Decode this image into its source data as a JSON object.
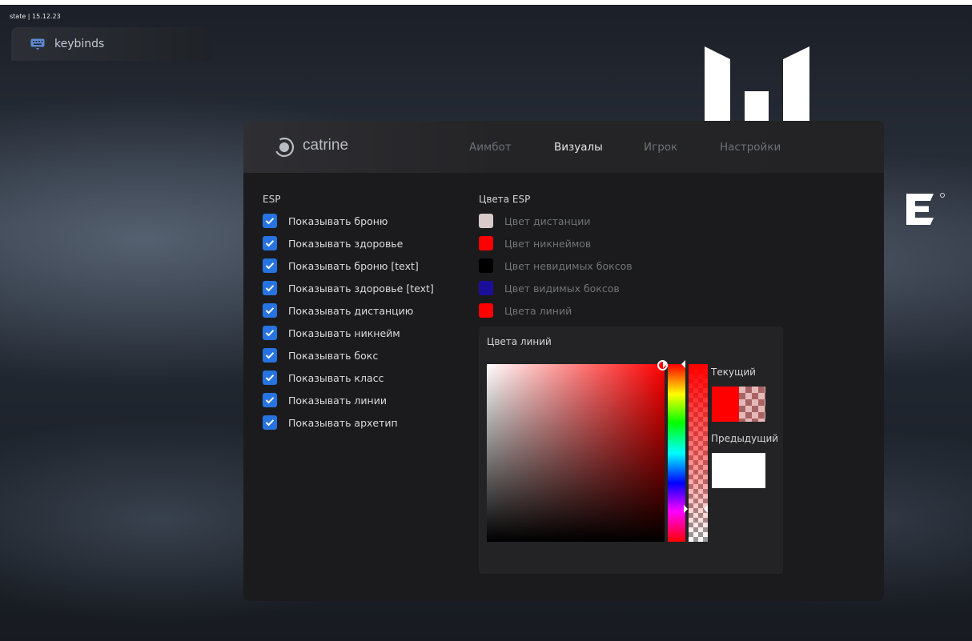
{
  "overlay": {
    "state_text": "state | 15.12.23"
  },
  "keybinds": {
    "label": "keybinds",
    "icon": "keyboard-icon"
  },
  "brand": {
    "name": "catrine",
    "icon": "target-ring-icon"
  },
  "tabs": [
    {
      "label": "Аимбот",
      "active": false
    },
    {
      "label": "Визуалы",
      "active": true
    },
    {
      "label": "Игрок",
      "active": false
    },
    {
      "label": "Настройки",
      "active": false
    }
  ],
  "esp": {
    "title": "ESP",
    "items": [
      {
        "label": "Показывать броню",
        "checked": true
      },
      {
        "label": "Показывать здоровье",
        "checked": true
      },
      {
        "label": "Показывать броню [text]",
        "checked": true
      },
      {
        "label": "Показывать здоровье [text]",
        "checked": true
      },
      {
        "label": "Показывать дистанцию",
        "checked": true
      },
      {
        "label": "Показывать никнейм",
        "checked": true
      },
      {
        "label": "Показывать бокс",
        "checked": true
      },
      {
        "label": "Показывать класс",
        "checked": true
      },
      {
        "label": "Показывать линии",
        "checked": true
      },
      {
        "label": "Показывать архетип",
        "checked": true
      }
    ]
  },
  "esp_colors": {
    "title": "Цвета ESP",
    "items": [
      {
        "label": "Цвет дистанции",
        "color": "#d9c9c9"
      },
      {
        "label": "Цвет никнеймов",
        "color": "#ff0000"
      },
      {
        "label": "Цвет невидимых боксов",
        "color": "#000000"
      },
      {
        "label": "Цвет видимых боксов",
        "color": "#1a0f9a"
      },
      {
        "label": "Цвета линий",
        "color": "#ff0000"
      }
    ]
  },
  "color_picker": {
    "title": "Цвета линий",
    "current_label": "Текущий",
    "previous_label": "Предыдущий",
    "current_color": "#ff0000",
    "previous_color": "#ffffff",
    "hue": 0,
    "saturation": 1.0,
    "value": 1.0,
    "alpha": 0.2
  }
}
